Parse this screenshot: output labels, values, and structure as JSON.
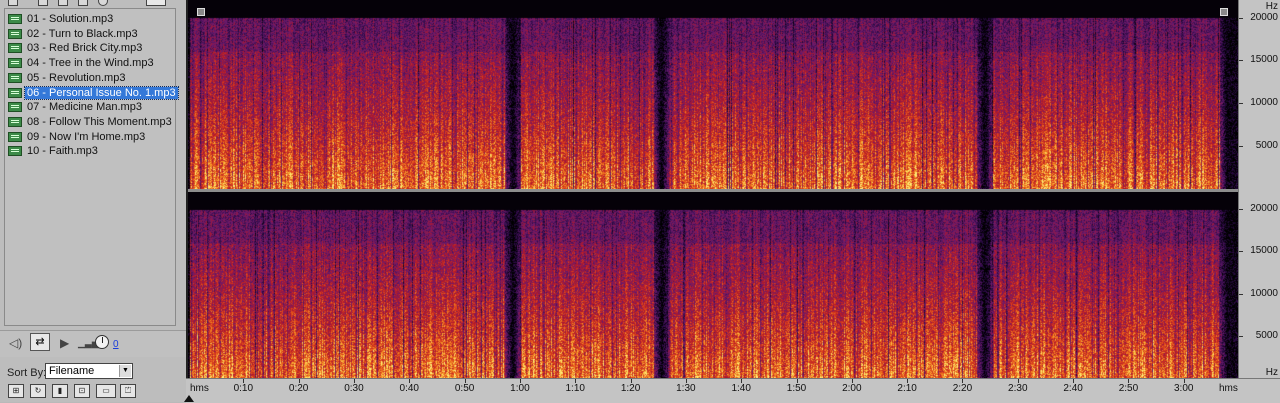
{
  "file_panel": {
    "files": [
      {
        "name": "01 - Solution.mp3",
        "selected": false
      },
      {
        "name": "02 - Turn to Black.mp3",
        "selected": false
      },
      {
        "name": "03 - Red Brick City.mp3",
        "selected": false
      },
      {
        "name": "04 - Tree in the Wind.mp3",
        "selected": false
      },
      {
        "name": "05 - Revolution.mp3",
        "selected": false
      },
      {
        "name": "06 - Personal Issue No. 1.mp3",
        "selected": true
      },
      {
        "name": "07 - Medicine Man.mp3",
        "selected": false
      },
      {
        "name": "08 - Follow This Moment.mp3",
        "selected": false
      },
      {
        "name": "09 - Now I'm Home.mp3",
        "selected": false
      },
      {
        "name": "10 - Faith.mp3",
        "selected": false
      }
    ],
    "volume_value": "0",
    "sort_label": "Sort By:",
    "sort_value": "Filename",
    "icons": {
      "file": "audio-file-icon",
      "speaker": "speaker-icon",
      "loop": "loop-icon",
      "play": "play-icon",
      "volume_bars": "volume-level-icon",
      "volume_knob": "volume-knob-icon"
    }
  },
  "spectral_view": {
    "freq_unit": "Hz",
    "freq_labels": [
      "20000",
      "15000",
      "10000",
      "5000"
    ],
    "freq_values": [
      20000,
      15000,
      10000,
      5000
    ],
    "freq_max": 22050,
    "time_unit_left": "hms",
    "time_unit_right": "hms",
    "time_labels": [
      "0:10",
      "0:20",
      "0:30",
      "0:40",
      "0:50",
      "1:00",
      "1:10",
      "1:20",
      "1:30",
      "1:40",
      "1:50",
      "2:00",
      "2:10",
      "2:20",
      "2:30",
      "2:40",
      "2:50",
      "3:00"
    ],
    "duration_seconds": 188,
    "song_gaps_seconds": [
      58.3,
      85.2,
      143.6,
      187.5
    ],
    "colors": {
      "background": "#000000",
      "low": "#2a0a44",
      "mid_low": "#6a1a6e",
      "mid": "#b0182c",
      "mid_high": "#e0451a",
      "high": "#f7a02a",
      "peak": "#fff27a"
    },
    "channels": 2
  }
}
